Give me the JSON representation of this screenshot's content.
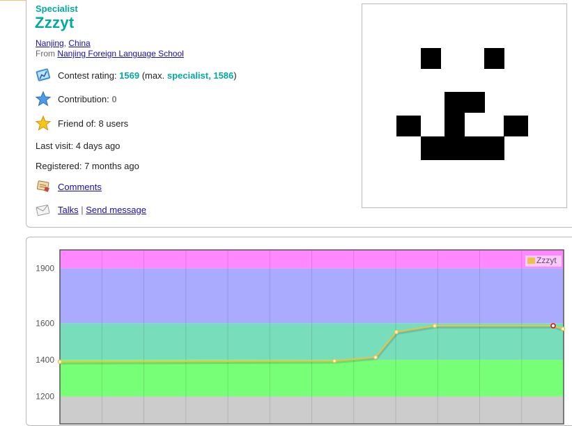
{
  "profile": {
    "rank": "Specialist",
    "handle": "Zzzyt",
    "city": "Nanjing",
    "country": "China",
    "from_prefix": "From",
    "organization": "Nanjing Foreign Language School",
    "contest_rating_label": "Contest rating:",
    "contest_rating": "1569",
    "max_prefix": "(max.",
    "max_rank": "specialist,",
    "max_rating": "1586",
    "max_suffix": ")",
    "contribution_label": "Contribution:",
    "contribution": "0",
    "friend_of": "Friend of: 8 users",
    "last_visit": "Last visit: 4 days ago",
    "registered": "Registered: 7 months ago",
    "comments": "Comments",
    "talks": "Talks",
    "separator": "|",
    "send_message": "Send message"
  },
  "icons": {
    "rating": "rating-chart-icon",
    "contribution": "star-blue-icon",
    "friends": "star-gold-icon",
    "comments": "comments-icon",
    "talks": "envelope-icon"
  },
  "colors": {
    "specialist": "#03a89e",
    "link": "#1a0dab",
    "contribution_zero": "#808080"
  },
  "chart_data": {
    "type": "line",
    "series": [
      {
        "name": "Zzzyt",
        "color": "#edc240",
        "values": [
          1389,
          1394,
          1414,
          1552,
          1586,
          1586,
          1569
        ]
      }
    ],
    "y_ticks": [
      1200,
      1400,
      1600,
      1900
    ],
    "ylim": [
      1050,
      2000
    ],
    "bands": [
      {
        "from": 1050,
        "to": 1200,
        "color": "#cccccc"
      },
      {
        "from": 1200,
        "to": 1400,
        "color": "#77ff77"
      },
      {
        "from": 1400,
        "to": 1600,
        "color": "#77ddbb"
      },
      {
        "from": 1600,
        "to": 1900,
        "color": "#aaaaff"
      },
      {
        "from": 1900,
        "to": 2000,
        "color": "#ff88ff"
      }
    ],
    "legend_position": "top-right",
    "max_marker_index": 5
  }
}
